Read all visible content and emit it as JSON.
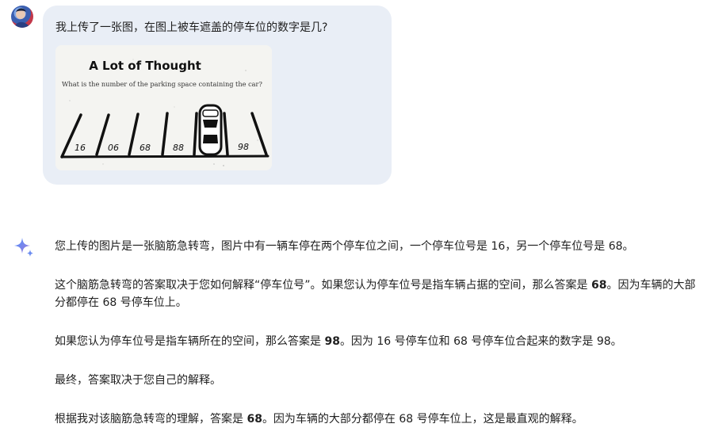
{
  "user": {
    "avatar_icon": "user-avatar",
    "prompt": "我上传了一张图，在图上被车遮盖的停车位的数字是几?",
    "image": {
      "title": "A Lot of Thought",
      "question": "What is the number of the parking space containing the car?",
      "space_numbers": [
        "16",
        "06",
        "68",
        "88",
        "98"
      ]
    }
  },
  "assistant": {
    "icon": "gemini-sparkle-icon",
    "paragraphs": [
      {
        "parts": [
          {
            "t": "您上传的图片是一张脑筋急转弯，图片中有一辆车停在两个停车位之间，一个停车位号是 16，另一个停车位号是 68。"
          }
        ]
      },
      {
        "parts": [
          {
            "t": "这个脑筋急转弯的答案取决于您如何解释“停车位号”。如果您认为停车位号是指车辆占据的空间，那么答案是 "
          },
          {
            "t": "68",
            "b": true
          },
          {
            "t": "。因为车辆的大部分都停在 68 号停车位上。"
          }
        ]
      },
      {
        "parts": [
          {
            "t": "如果您认为停车位号是指车辆所在的空间，那么答案是 "
          },
          {
            "t": "98",
            "b": true
          },
          {
            "t": "。因为 16 号停车位和 68 号停车位合起来的数字是 98。"
          }
        ]
      },
      {
        "parts": [
          {
            "t": "最终，答案取决于您自己的解释。"
          }
        ]
      },
      {
        "parts": [
          {
            "t": "根据我对该脑筋急转弯的理解，答案是 "
          },
          {
            "t": "68",
            "b": true
          },
          {
            "t": "。因为车辆的大部分都停在 68 号停车位上，这是最直观的解释。"
          }
        ]
      }
    ]
  }
}
